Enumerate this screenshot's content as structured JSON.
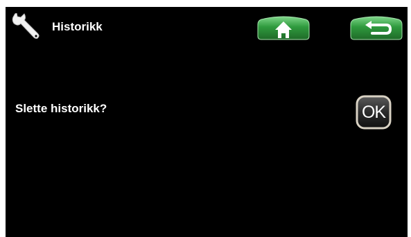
{
  "header": {
    "icon": "wrench-icon",
    "title": "Historikk",
    "home_icon": "home-icon",
    "back_icon": "back-arrow-icon"
  },
  "dialog": {
    "prompt": "Slette historikk?",
    "ok_label": "OK"
  },
  "colors": {
    "background": "#000000",
    "text": "#ffffff",
    "nav_button": "#2f9a3e",
    "ok_button_border": "#d9d2c4"
  }
}
